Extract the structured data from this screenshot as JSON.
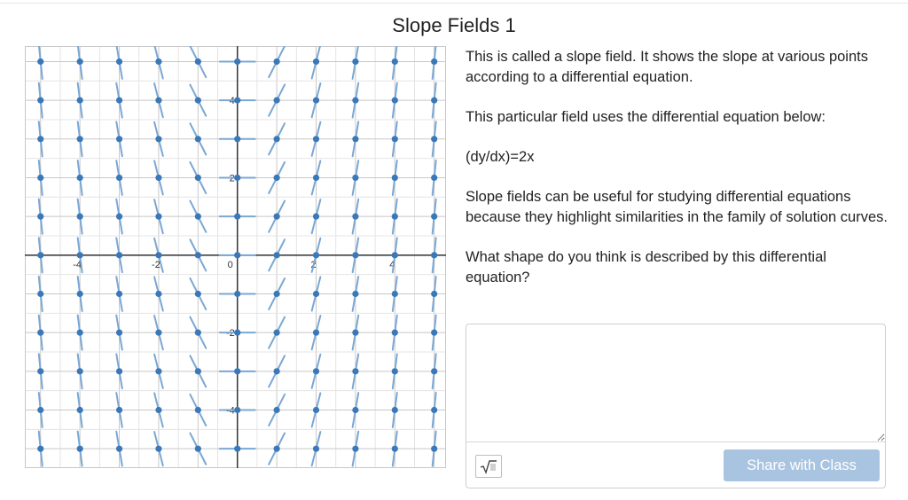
{
  "activity": {
    "title": "Slope Fields 1"
  },
  "description": {
    "para1": "This is called a slope field. It shows the slope at various points according to a differential equation.",
    "para2": "This particular field uses the differential equation below:",
    "equation": "(dy/dx)=2x",
    "para3": "Slope fields can be useful for studying differential equations because they highlight similarities in the family of solution curves.",
    "question": "What shape do you think is described by this differential equation?"
  },
  "response": {
    "input_value": "",
    "math_icon": "square-root-icon",
    "share_label": "Share with Class"
  },
  "graph": {
    "x_range": [
      -5.4,
      5.3
    ],
    "y_range": [
      -5.5,
      5.4
    ],
    "x_tick_labels": [
      "-4",
      "-2",
      "0",
      "2",
      "4"
    ],
    "y_tick_labels": [
      "4",
      "2",
      "-2",
      "-4"
    ],
    "grid": "minor lines every 0.5, major every 1",
    "slope_segments": {
      "equation": "dy/dx = 2x",
      "x_values": [
        -5,
        -4,
        -3,
        -2,
        -1,
        0,
        1,
        2,
        3,
        4,
        5
      ],
      "y_values": [
        5,
        4,
        3,
        2,
        1,
        0,
        -1,
        -2,
        -3,
        -4,
        -5
      ]
    },
    "colors": {
      "segment": "#7aa7d4",
      "point": "#3b78b8",
      "axis": "#333333",
      "grid_major": "#c8c8c8",
      "grid_minor": "#e4e4e4"
    }
  }
}
